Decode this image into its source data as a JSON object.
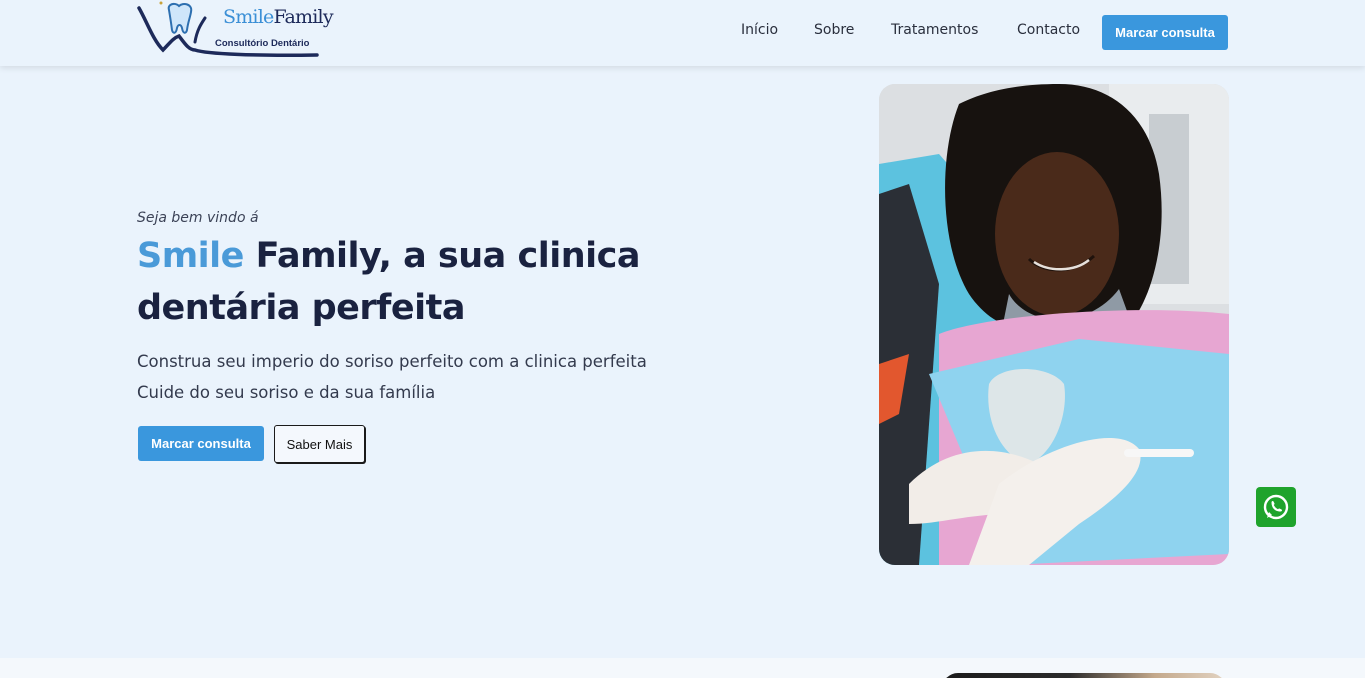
{
  "brand": {
    "name_part1": "Smile",
    "name_part2": "Family",
    "subtitle": "Consultório Dentário",
    "colors": {
      "accent": "#3a97dd",
      "navy": "#1d2a5a"
    }
  },
  "nav": {
    "links": [
      "Início",
      "Sobre",
      "Tratamentos",
      "Contacto"
    ],
    "cta_label": "Marcar consulta"
  },
  "hero": {
    "welcome": "Seja bem vindo á",
    "headline_accent": "Smile",
    "headline_line1_rest": "Family, a sua clinica",
    "headline_line2": "dentária perfeita",
    "desc_line1": "Construa seu imperio do soriso perfeito com a clinica perfeita",
    "desc_line2": "Cuide do seu soriso e da sua família",
    "primary_button": "Marcar consulta",
    "secondary_button": "Saber Mais",
    "image_icon": "patient-photo"
  },
  "floating": {
    "whatsapp_icon": "whatsapp-icon",
    "color": "#1fa32c"
  }
}
